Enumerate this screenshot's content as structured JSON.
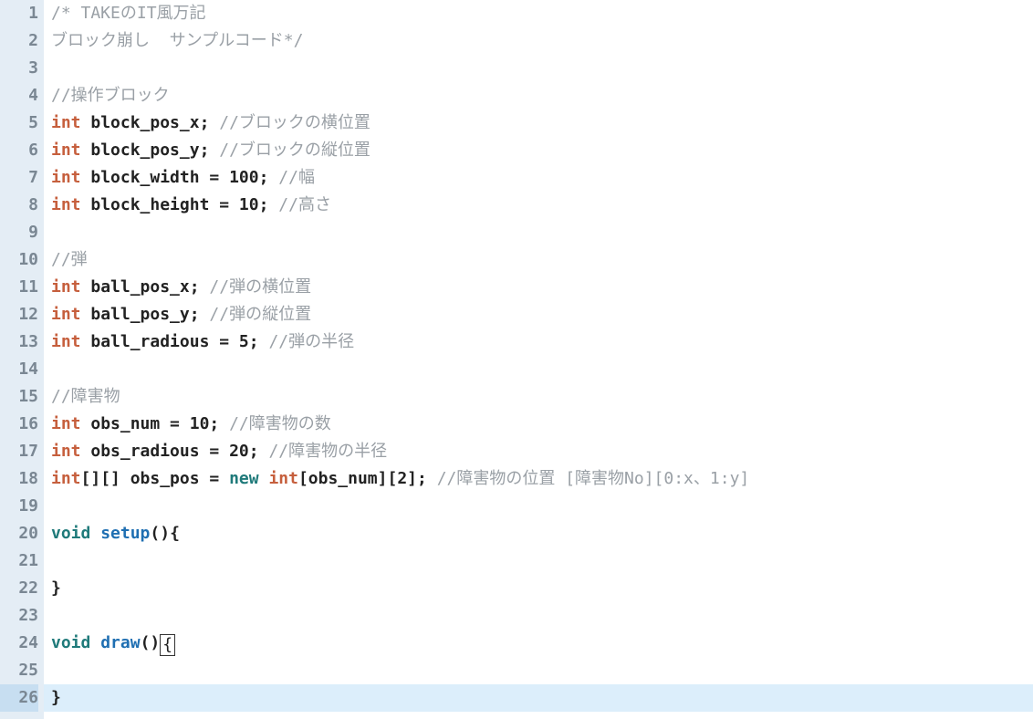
{
  "editor": {
    "current_line": 26,
    "lines": [
      {
        "n": 1,
        "tokens": [
          {
            "cls": "tk-comment",
            "t": "/* TAKEのIT風万記"
          }
        ]
      },
      {
        "n": 2,
        "tokens": [
          {
            "cls": "tk-comment",
            "t": "ブロック崩し  サンプルコード*/"
          }
        ]
      },
      {
        "n": 3,
        "tokens": []
      },
      {
        "n": 4,
        "tokens": [
          {
            "cls": "tk-comment",
            "t": "//操作ブロック"
          }
        ]
      },
      {
        "n": 5,
        "tokens": [
          {
            "cls": "tk-kwtype",
            "t": "int"
          },
          {
            "cls": "",
            "t": " "
          },
          {
            "cls": "tk-ident",
            "t": "block_pos_x;"
          },
          {
            "cls": "",
            "t": " "
          },
          {
            "cls": "tk-comment",
            "t": "//ブロックの横位置"
          }
        ]
      },
      {
        "n": 6,
        "tokens": [
          {
            "cls": "tk-kwtype",
            "t": "int"
          },
          {
            "cls": "",
            "t": " "
          },
          {
            "cls": "tk-ident",
            "t": "block_pos_y;"
          },
          {
            "cls": "",
            "t": " "
          },
          {
            "cls": "tk-comment",
            "t": "//ブロックの縦位置"
          }
        ]
      },
      {
        "n": 7,
        "tokens": [
          {
            "cls": "tk-kwtype",
            "t": "int"
          },
          {
            "cls": "",
            "t": " "
          },
          {
            "cls": "tk-ident",
            "t": "block_width = 100;"
          },
          {
            "cls": "",
            "t": " "
          },
          {
            "cls": "tk-comment",
            "t": "//幅"
          }
        ]
      },
      {
        "n": 8,
        "tokens": [
          {
            "cls": "tk-kwtype",
            "t": "int"
          },
          {
            "cls": "",
            "t": " "
          },
          {
            "cls": "tk-ident",
            "t": "block_height = 10;"
          },
          {
            "cls": "",
            "t": " "
          },
          {
            "cls": "tk-comment",
            "t": "//高さ"
          }
        ]
      },
      {
        "n": 9,
        "tokens": []
      },
      {
        "n": 10,
        "tokens": [
          {
            "cls": "tk-comment",
            "t": "//弾"
          }
        ]
      },
      {
        "n": 11,
        "tokens": [
          {
            "cls": "tk-kwtype",
            "t": "int"
          },
          {
            "cls": "",
            "t": " "
          },
          {
            "cls": "tk-ident",
            "t": "ball_pos_x;"
          },
          {
            "cls": "",
            "t": " "
          },
          {
            "cls": "tk-comment",
            "t": "//弾の横位置"
          }
        ]
      },
      {
        "n": 12,
        "tokens": [
          {
            "cls": "tk-kwtype",
            "t": "int"
          },
          {
            "cls": "",
            "t": " "
          },
          {
            "cls": "tk-ident",
            "t": "ball_pos_y;"
          },
          {
            "cls": "",
            "t": " "
          },
          {
            "cls": "tk-comment",
            "t": "//弾の縦位置"
          }
        ]
      },
      {
        "n": 13,
        "tokens": [
          {
            "cls": "tk-kwtype",
            "t": "int"
          },
          {
            "cls": "",
            "t": " "
          },
          {
            "cls": "tk-ident",
            "t": "ball_radious = 5;"
          },
          {
            "cls": "",
            "t": " "
          },
          {
            "cls": "tk-comment",
            "t": "//弾の半径"
          }
        ]
      },
      {
        "n": 14,
        "tokens": []
      },
      {
        "n": 15,
        "tokens": [
          {
            "cls": "tk-comment",
            "t": "//障害物"
          }
        ]
      },
      {
        "n": 16,
        "tokens": [
          {
            "cls": "tk-kwtype",
            "t": "int"
          },
          {
            "cls": "",
            "t": " "
          },
          {
            "cls": "tk-ident",
            "t": "obs_num = 10;"
          },
          {
            "cls": "",
            "t": " "
          },
          {
            "cls": "tk-comment",
            "t": "//障害物の数"
          }
        ]
      },
      {
        "n": 17,
        "tokens": [
          {
            "cls": "tk-kwtype",
            "t": "int"
          },
          {
            "cls": "",
            "t": " "
          },
          {
            "cls": "tk-ident",
            "t": "obs_radious = 20;"
          },
          {
            "cls": "",
            "t": " "
          },
          {
            "cls": "tk-comment",
            "t": "//障害物の半径"
          }
        ]
      },
      {
        "n": 18,
        "tokens": [
          {
            "cls": "tk-kwtype",
            "t": "int"
          },
          {
            "cls": "tk-ident",
            "t": "[][] obs_pos = "
          },
          {
            "cls": "tk-kwvoid",
            "t": "new"
          },
          {
            "cls": "",
            "t": " "
          },
          {
            "cls": "tk-kwtype",
            "t": "int"
          },
          {
            "cls": "tk-ident",
            "t": "[obs_num][2];"
          },
          {
            "cls": "",
            "t": " "
          },
          {
            "cls": "tk-comment",
            "t": "//障害物の位置 [障害物No][0:x、1:y]"
          }
        ]
      },
      {
        "n": 19,
        "tokens": []
      },
      {
        "n": 20,
        "tokens": [
          {
            "cls": "tk-kwvoid",
            "t": "void"
          },
          {
            "cls": "",
            "t": " "
          },
          {
            "cls": "tk-func",
            "t": "setup"
          },
          {
            "cls": "tk-ident",
            "t": "(){"
          }
        ]
      },
      {
        "n": 21,
        "tokens": []
      },
      {
        "n": 22,
        "tokens": [
          {
            "cls": "tk-ident",
            "t": "}"
          }
        ]
      },
      {
        "n": 23,
        "tokens": []
      },
      {
        "n": 24,
        "tokens": [
          {
            "cls": "tk-kwvoid",
            "t": "void"
          },
          {
            "cls": "",
            "t": " "
          },
          {
            "cls": "tk-func",
            "t": "draw"
          },
          {
            "cls": "tk-ident",
            "t": "()"
          },
          {
            "cls": "cursor-box",
            "t": "{"
          }
        ]
      },
      {
        "n": 25,
        "tokens": []
      },
      {
        "n": 26,
        "tokens": [
          {
            "cls": "tk-ident",
            "t": "}"
          }
        ]
      }
    ]
  }
}
